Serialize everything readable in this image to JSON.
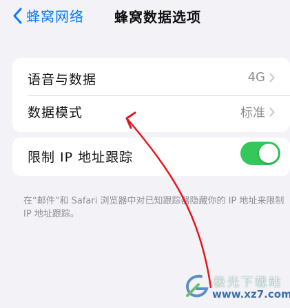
{
  "nav": {
    "back_label": "蜂窝网络",
    "title": "蜂窝数据选项"
  },
  "rows": {
    "voice_data": {
      "label": "语音与数据",
      "value": "4G"
    },
    "data_mode": {
      "label": "数据模式",
      "value": "标准"
    },
    "limit_ip": {
      "label": "限制 IP 地址跟踪",
      "toggle_on": true
    }
  },
  "footnote": "在“邮件”和 Safari 浏览器中对已知跟踪器隐藏你的 IP 地址来限制 IP 地址跟踪。",
  "colors": {
    "accent": "#0a7aff",
    "toggle_on": "#34c759",
    "annotation_arrow": "#e8141b"
  },
  "watermark": {
    "name": "极光下载站",
    "url": "www.xz7.com"
  }
}
